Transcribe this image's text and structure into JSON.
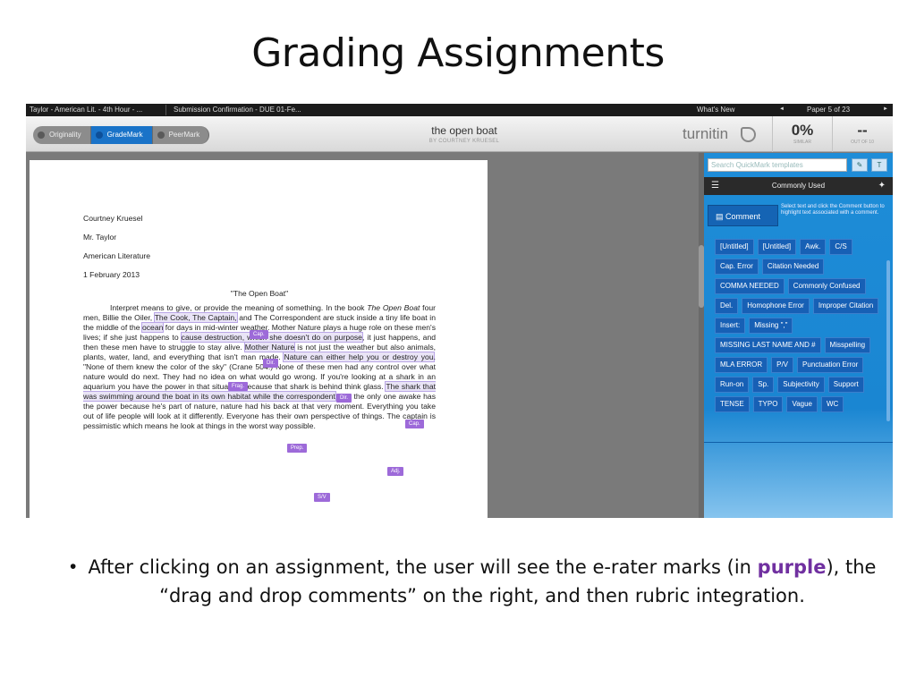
{
  "slide": {
    "title": "Grading Assignments",
    "bullet_pre": "After clicking on an assignment, the user will see the e-rater marks (in ",
    "bullet_purple": "purple",
    "bullet_post": "),  the “drag and drop comments” on the right, and then rubric integration.",
    "bullet_symbol": "•"
  },
  "topbar": {
    "class_tab": "Taylor - American Lit. - 4th Hour - ...",
    "submission_tab": "Submission Confirmation - DUE 01-Fe...",
    "whats_new": "What's New",
    "prev": "◄",
    "pager": "Paper 5 of 23",
    "next": "►"
  },
  "header": {
    "modes": [
      "Originality",
      "GradeMark",
      "PeerMark"
    ],
    "active_mode": "GradeMark",
    "paper_title": "the open boat",
    "paper_author": "BY COURTNEY KRUESEL",
    "logo_text": "turnitin",
    "similarity_value": "0%",
    "similarity_label": "SIMILAR",
    "score_value": "--",
    "score_label": "OUT OF 10"
  },
  "document": {
    "meta": [
      "Courtney Kruesel",
      "Mr. Taylor",
      "American Literature",
      "1 February 2013"
    ],
    "essay_title": "\"The Open Boat\"",
    "s1": "Interpret means to give, or provide the meaning of something. In the book ",
    "s1_italic": "The Open Boat",
    "s2": " four men, Billie the Oiler, ",
    "s2_hl": "The Cook, The Captain,",
    "s3": " and The Correspondent are stuck inside a tiny life boat in the middle of the ",
    "s3_hl": "ocean",
    "s4": " for days in mid-winter weather. Mother Nature plays a huge role on these men's lives; if she just happens to ",
    "s4_hl": "cause destruction, which she doesn't do on purpose",
    "s5": ", it just happens, and then these men have to struggle to stay alive. ",
    "s5_hl": "Mother Nature",
    "s6": " is not just the weather but also animals, plants, water, land, and everything that isn't man made. ",
    "s6_hl": "Nature can either help you or destroy you",
    "s7": ". \"None of them knew the color of the sky\" (Crane 504.) None of these men had any control over what nature would do next. They had no idea on what would go wrong. If you're looking at a shark in an aquarium you have the power in that situation because that shark is behind think glass. ",
    "s7_hl": "The shark that was swimming around the boat in its own habitat while the correspondent",
    "s8": " was the only one awake has the power because he's part of nature, nature had his back at that very moment. Everything you take out of life people will look at it differently. Everyone has their own perspective of things. The captain is pessimistic  which means he look at things in the worst way possible.",
    "marks": [
      "Cap.",
      "Dir.",
      "Frag.",
      "Dir.",
      "Cap.",
      "Prep.",
      "Adj.",
      "S/V"
    ]
  },
  "quickmark": {
    "search_placeholder": "Search QuickMark templates",
    "set_label": "Commonly Used",
    "comment_button": "Comment",
    "comment_desc": "Select text and click the Comment button to highlight text associated with a comment.",
    "tags": [
      "[Untitled]",
      "[Untitled]",
      "Awk.",
      "C/S",
      "Cap. Error",
      "Citation Needed",
      "COMMA NEEDED",
      "Commonly Confused",
      "Del.",
      "Homophone Error",
      "Improper Citation",
      "Insert:",
      "Missing \",\"",
      "MISSING LAST NAME AND #",
      "Misspelling",
      "MLA ERROR",
      "P/V",
      "Punctuation Error",
      "Run-on",
      "Sp.",
      "Subjectivity",
      "Support",
      "TENSE",
      "TYPO",
      "Vague",
      "WC"
    ]
  }
}
